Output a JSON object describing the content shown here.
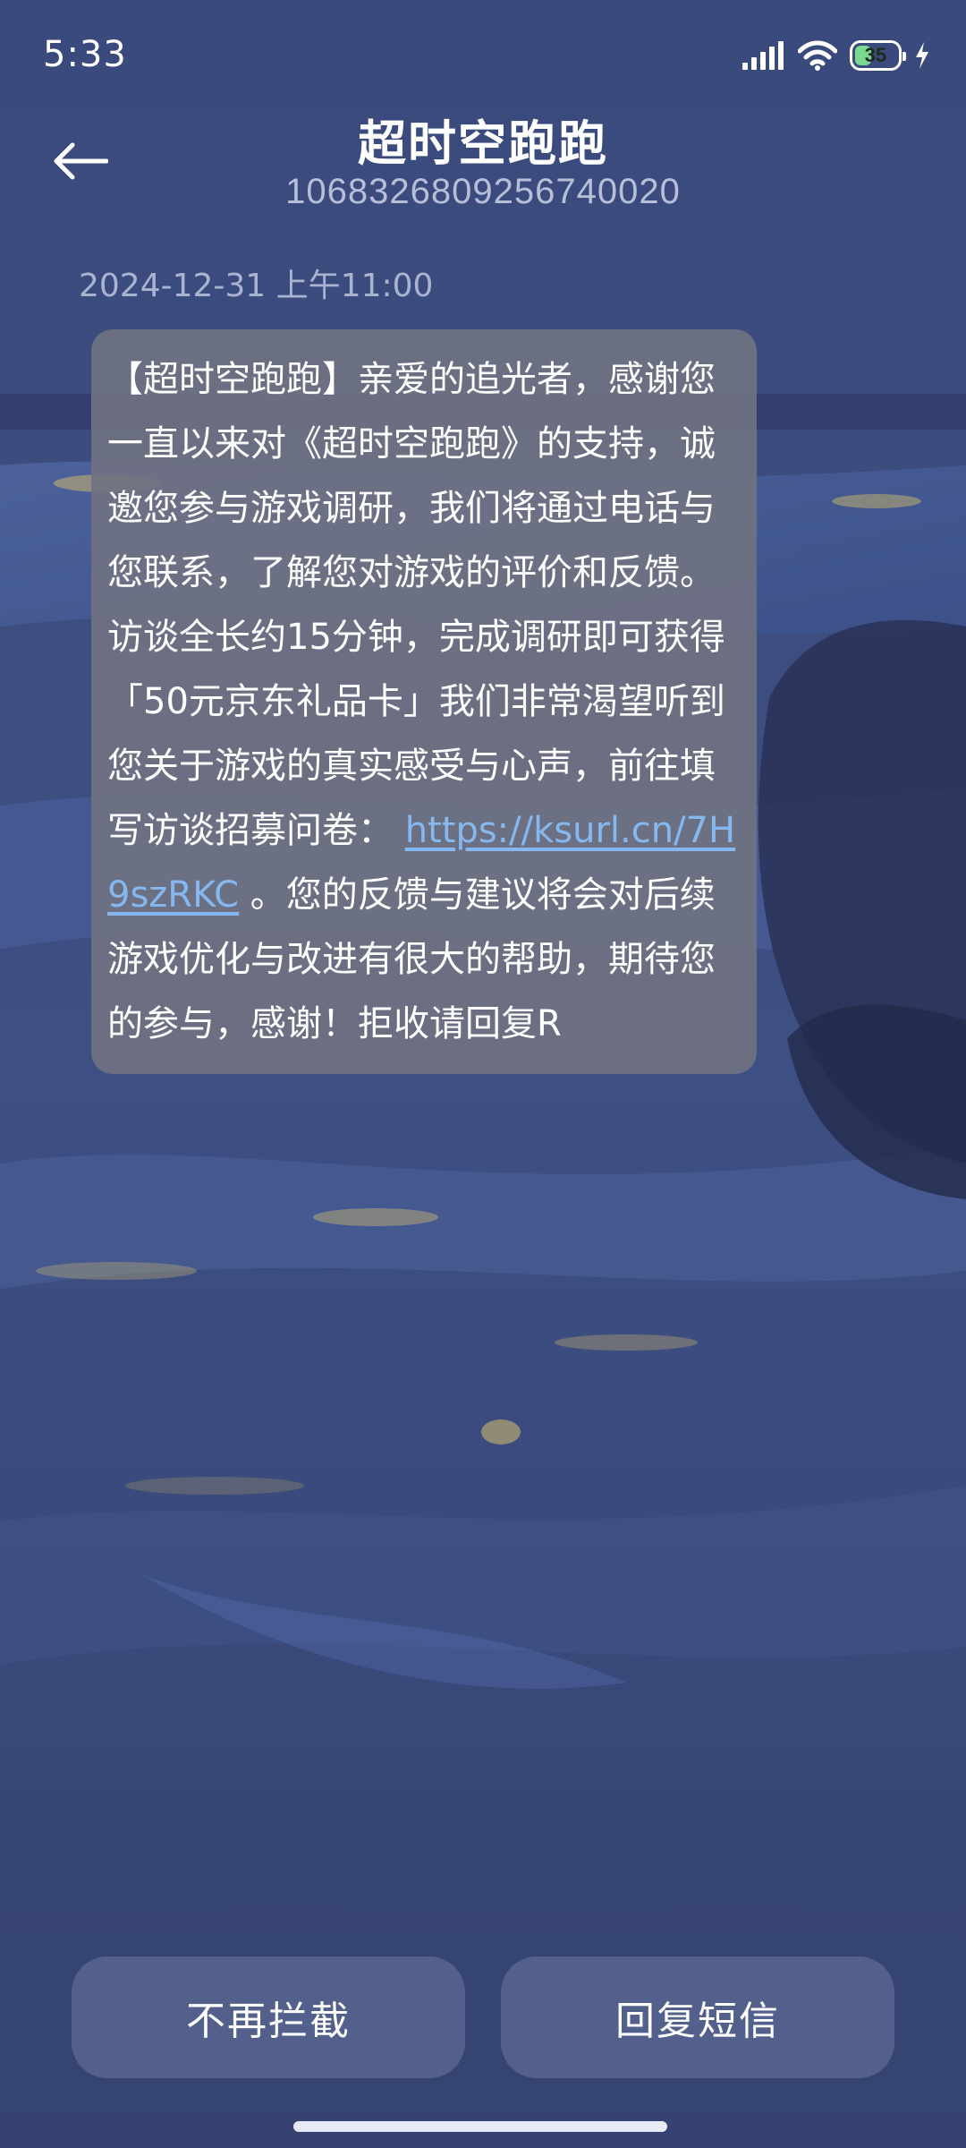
{
  "status_bar": {
    "time": "5:33",
    "battery_level": "35",
    "icons": [
      "signal-icon",
      "wifi-icon",
      "battery-icon",
      "charging-icon"
    ]
  },
  "header": {
    "back_icon": "back-arrow-icon",
    "contact_name": "超时空跑跑",
    "contact_number": "1068326809256740020"
  },
  "message": {
    "timestamp": "2024-12-31 上午11:00",
    "text_before_link": "【超时空跑跑】亲爱的追光者，感谢您一直以来对《超时空跑跑》的支持，诚邀您参与游戏调研，我们将通过电话与您联系，了解您对游戏的评价和反馈。访谈全长约15分钟，完成调研即可获得「50元京东礼品卡」我们非常渴望听到您关于游戏的真实感受与心声，前往填写访谈招募问卷：",
    "link": "https://ksurl.cn/7H9szRKC",
    "text_after_link": "。您的反馈与建议将会对后续游戏优化与改进有很大的帮助，期待您的参与，感谢！拒收请回复R"
  },
  "actions": {
    "unblock_label": "不再拦截",
    "reply_label": "回复短信"
  },
  "colors": {
    "background": "#3a4878",
    "bubble": "#70727f",
    "link": "#86b8f0",
    "battery_fill": "#7bd88f"
  }
}
